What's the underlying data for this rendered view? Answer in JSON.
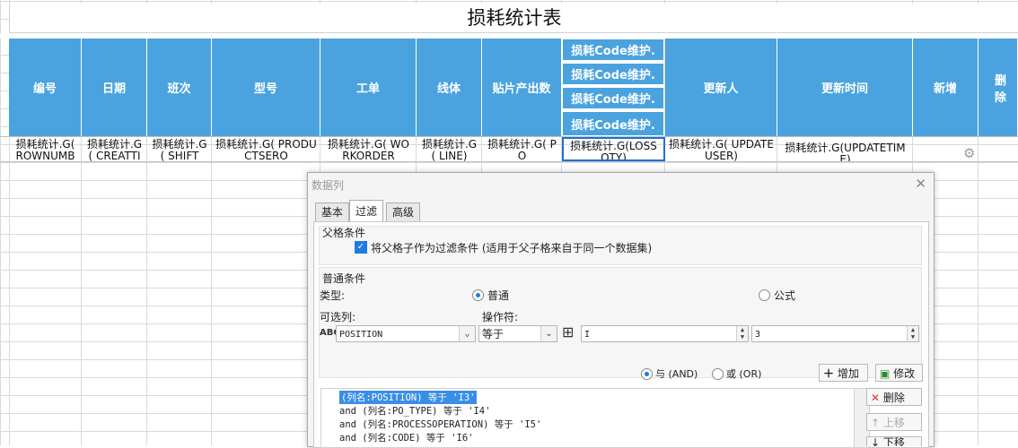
{
  "sheet_title": "损耗统计表",
  "headers": [
    "编号",
    "日期",
    "班次",
    "型号",
    "工单",
    "线体",
    "贴片产出数",
    "更新人",
    "更新时间",
    "新增",
    "删除"
  ],
  "loss_headers": [
    "损耗Code维护.",
    "损耗Code维护.",
    "损耗Code维护.",
    "损耗Code维护."
  ],
  "row_cells": [
    "损耗统计.G( ROWNUMBE",
    "损耗统计.G( CREATTIME",
    "损耗统计.G( SHIFT",
    "损耗统计.G( PRODUCTSERO",
    "损耗统计.G( WORKORDER",
    "损耗统计.G( LINE)",
    "损耗统计.G( PO",
    "损耗统计.G(LOSS QTY)",
    "损耗统计.G( UPDATEUSER)",
    "损耗统计.G(UPDATETIME)"
  ],
  "icons": {
    "gear": "gear-icon"
  },
  "dialog": {
    "title": "数据列",
    "tabs": [
      "基本",
      "过滤",
      "高级"
    ],
    "parent_section": "父格条件",
    "parent_checkbox": "将父格子作为过滤条件 (适用于父子格来自于同一个数据集)",
    "normal_section": "普通条件",
    "type_label": "类型:",
    "type_normal": "普通",
    "type_formula": "公式",
    "column_label": "可选列:",
    "operator_label": "操作符:",
    "column_value": "POSITION",
    "operator_value": "等于",
    "value1": "I",
    "value2": "3",
    "and_label": "与 (AND)",
    "or_label": "或 (OR)",
    "add_button": "增加",
    "modify_button": "修改",
    "delete_button": "删除",
    "up_button": "上移",
    "down_button": "下移",
    "conditions": [
      "(列名:POSITION) 等于 'I3'",
      "and (列名:PO_TYPE) 等于 'I4'",
      "and (列名:PROCESSOPERATION) 等于 'I5'",
      "and (列名:CODE) 等于 'I6'"
    ]
  }
}
